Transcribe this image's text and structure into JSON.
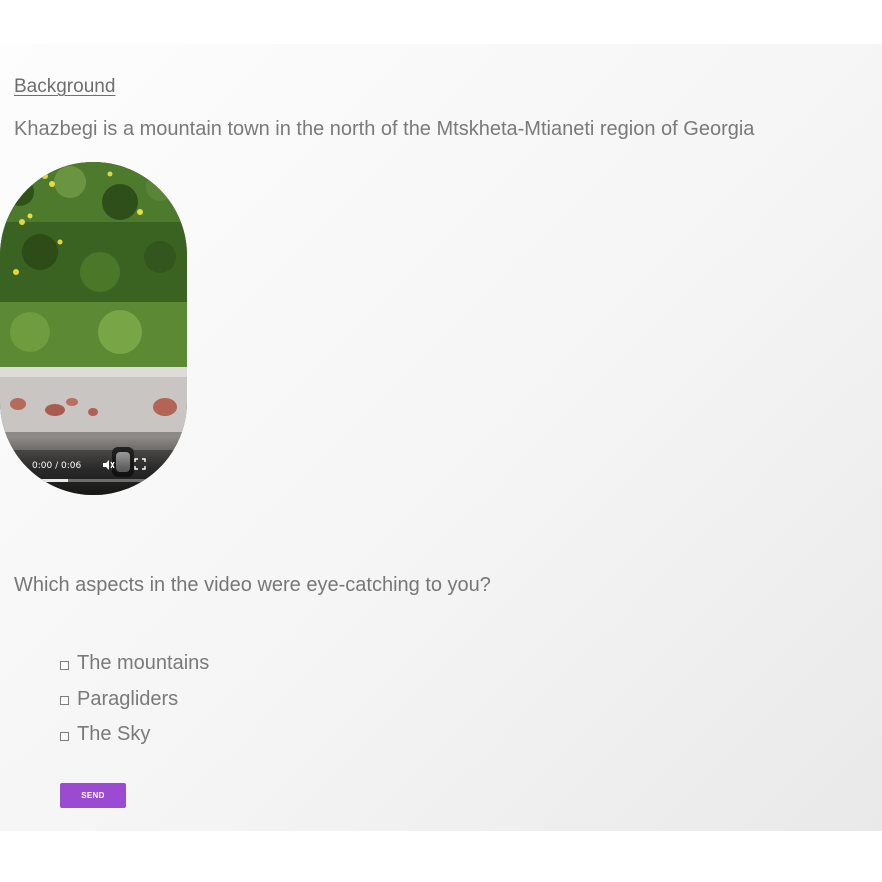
{
  "background_link": "Background",
  "intro_text": "Khazbegi is a mountain town in the north of the Mtskheta-Mtianeti region of Georgia",
  "video": {
    "time": "0:00 / 0:06",
    "progress_fraction": 0.3
  },
  "question": "Which aspects in the video were eye-catching to you?",
  "options": [
    "The mountains",
    "Paragliders",
    "The Sky"
  ],
  "send_label": "SEND",
  "colors": {
    "accent": "#9b4bd1",
    "text": "#7a7a7a"
  },
  "icons": [
    "play-icon",
    "mute-icon",
    "fullscreen-icon",
    "more-options-icon"
  ]
}
